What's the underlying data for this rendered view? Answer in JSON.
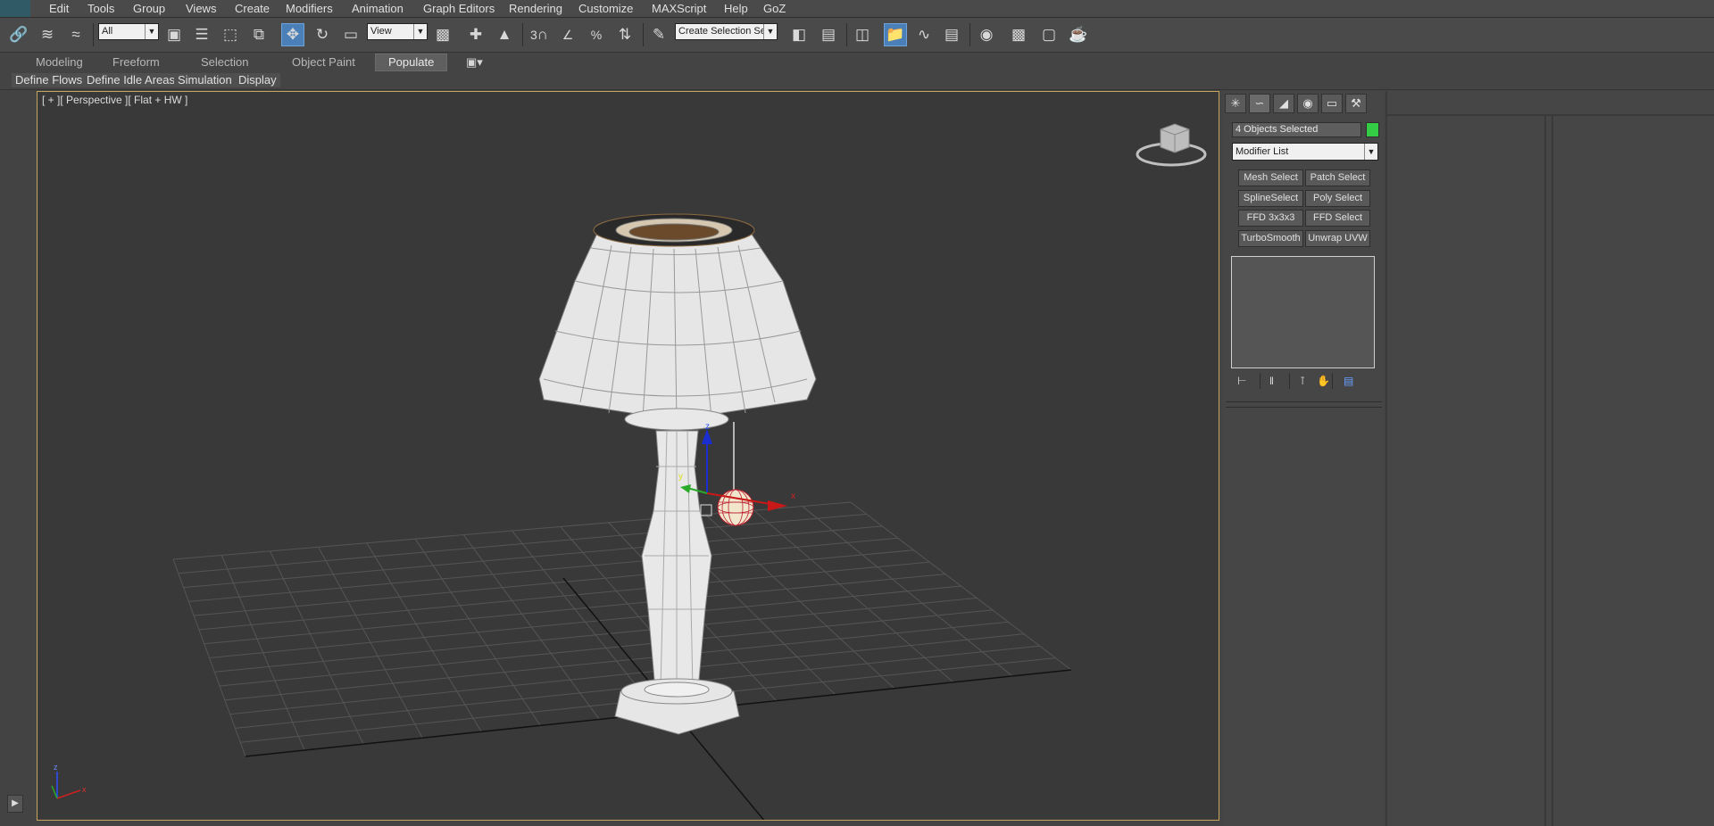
{
  "menu": [
    "Edit",
    "Tools",
    "Group",
    "Views",
    "Create",
    "Modifiers",
    "Animation",
    "Graph Editors",
    "Rendering",
    "Customize",
    "MAXScript",
    "Help",
    "GoZ"
  ],
  "toolbar": {
    "selection_filter": "All",
    "ref_coord_system": "View",
    "named_selection_placeholder": "Create Selection Se",
    "snap_3d_label": "3",
    "angle_snap_label": "∠",
    "percent_snap_label": "%"
  },
  "ribbon": {
    "tabs": [
      "Modeling",
      "Freeform",
      "Selection",
      "Object Paint",
      "Populate"
    ],
    "active_tab": "Populate",
    "sub_tabs": [
      "Define Flows",
      "Define Idle Areas",
      "Simulation",
      "Display"
    ]
  },
  "viewport": {
    "label": "[ + ][ Perspective ][ Flat + HW ]",
    "axis_z": "z",
    "axis_x": "x",
    "axis_y": "y",
    "shade_color": "#ffffff",
    "grid_color": "#555555",
    "border_color": "#c8a55c"
  },
  "command_panel": {
    "tabs": [
      "create-icon",
      "modify-icon",
      "hierarchy-icon",
      "motion-icon",
      "display-icon",
      "utilities-icon"
    ],
    "selection_text": "4 Objects Selected",
    "color_swatch": "#33cc44",
    "modifier_list": "Modifier List",
    "modifier_buttons": [
      "Mesh Select",
      "Patch Select",
      "SplineSelect",
      "Poly Select",
      "FFD 3x3x3",
      "FFD Select",
      "TurboSmooth",
      "Unwrap UVW"
    ]
  }
}
